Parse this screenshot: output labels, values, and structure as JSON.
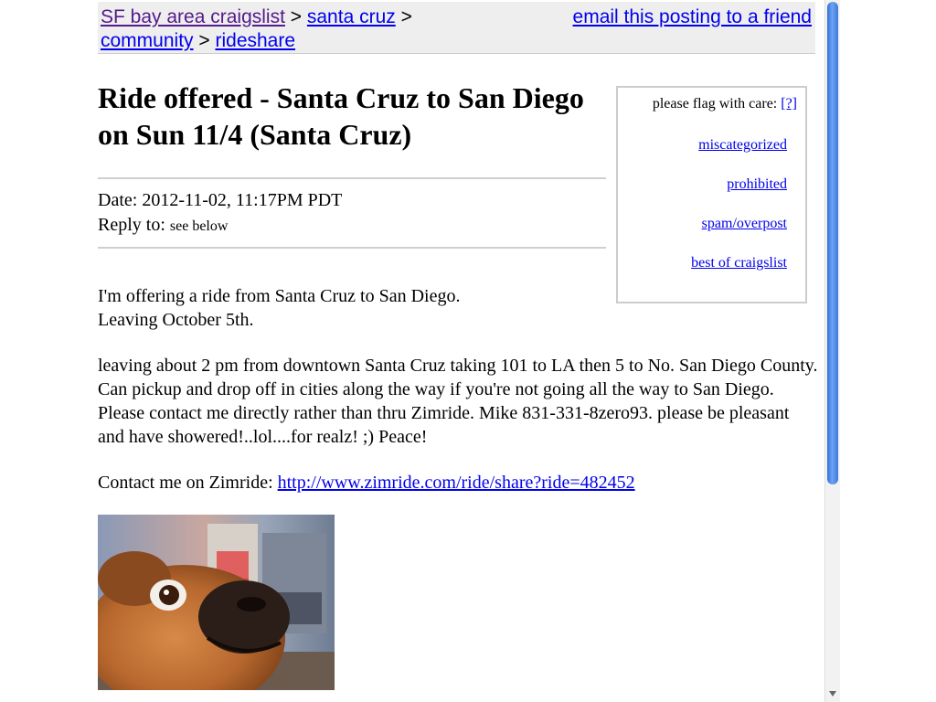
{
  "breadcrumb": {
    "site": "SF bay area craigslist",
    "sep1": ">",
    "area": "santa cruz",
    "sep2": ">",
    "section": "community",
    "sep3": ">",
    "category": "rideshare"
  },
  "email_link": "email this posting to a friend",
  "title": "Ride offered - Santa Cruz to San Diego on Sun 11/4 (Santa Cruz)",
  "date_label": "Date:",
  "date_value": "2012-11-02, 11:17PM PDT",
  "reply_label": "Reply to:",
  "reply_value": "see below",
  "flag": {
    "header": "please flag with care:",
    "help": "[?]",
    "items": [
      "miscategorized",
      "prohibited",
      "spam/overpost",
      "best of craigslist"
    ]
  },
  "body": {
    "line1": "I'm offering a ride from Santa Cruz to San Diego.",
    "line2": "Leaving October 5th.",
    "paragraph": "leaving about 2 pm from downtown Santa Cruz taking 101 to LA then 5 to No. San Diego County. Can pickup and drop off in cities along the way if you're not going all the way to San Diego. Please contact me directly rather than thru Zimride. Mike 831-331-8zero93. please be pleasant and have showered!..lol....for realz! ;) Peace!",
    "contact_label": "Contact me on Zimride:",
    "contact_link": "http://www.zimride.com/ride/share?ride=482452"
  },
  "colors": {
    "link": "#0000ee",
    "visited": "#551a8b",
    "header_bg": "#eeeeee",
    "scroll_thumb": "#4a86e8"
  },
  "icons": [
    "dog-photo",
    "scroll-down-arrow"
  ]
}
